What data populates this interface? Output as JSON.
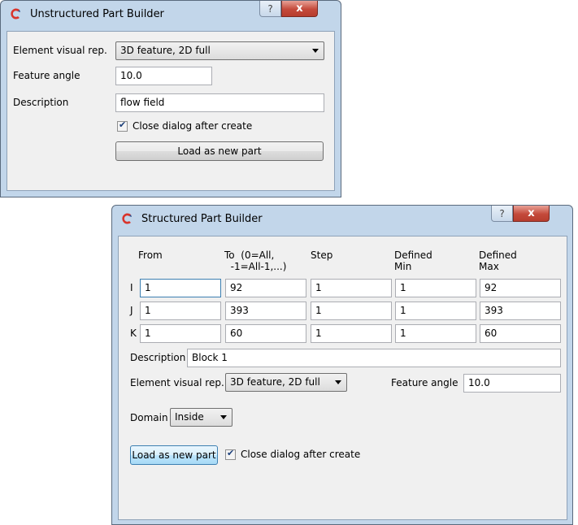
{
  "unstructured": {
    "title": "Unstructured Part Builder",
    "help_glyph": "?",
    "close_glyph": "x",
    "element_visual_label": "Element visual rep.",
    "element_visual_value": "3D feature, 2D full",
    "feature_angle_label": "Feature angle",
    "feature_angle_value": "10.0",
    "description_label": "Description",
    "description_value": "flow field",
    "close_dialog_label": "Close dialog after create",
    "close_dialog_checked": true,
    "load_button": "Load as new part"
  },
  "structured": {
    "title": "Structured Part Builder",
    "help_glyph": "?",
    "close_glyph": "x",
    "headers": {
      "from": "From",
      "to_line1": "To  (0=All,",
      "to_line2": "  -1=All-1,...)",
      "step": "Step",
      "dmin_line1": "Defined",
      "dmin_line2": "Min",
      "dmax_line1": "Defined",
      "dmax_line2": "Max"
    },
    "rows": [
      {
        "axis": "I",
        "from": "1",
        "to": "92",
        "step": "1",
        "min": "1",
        "max": "92"
      },
      {
        "axis": "J",
        "from": "1",
        "to": "393",
        "step": "1",
        "min": "1",
        "max": "393"
      },
      {
        "axis": "K",
        "from": "1",
        "to": "60",
        "step": "1",
        "min": "1",
        "max": "60"
      }
    ],
    "description_label": "Description",
    "description_value": "Block 1",
    "element_visual_label": "Element visual rep.",
    "element_visual_value": "3D feature, 2D full",
    "feature_angle_label": "Feature angle",
    "feature_angle_value": "10.0",
    "domain_label": "Domain",
    "domain_value": "Inside",
    "load_button": "Load as new part",
    "close_dialog_label": "Close dialog after create",
    "close_dialog_checked": true
  },
  "colors": {
    "frame": "#c2d6ea",
    "client": "#f0f0f0",
    "close_button": "#c44a3b",
    "app_icon_red": "#d9342b"
  }
}
